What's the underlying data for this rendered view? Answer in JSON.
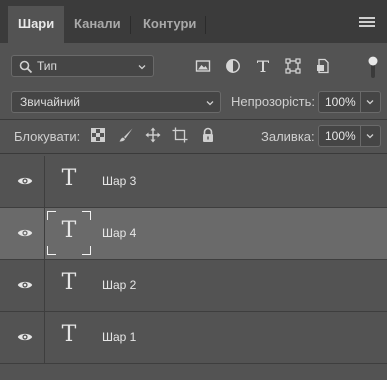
{
  "tabs": [
    {
      "label": "Шари",
      "active": true
    },
    {
      "label": "Канали",
      "active": false
    },
    {
      "label": "Контури",
      "active": false
    }
  ],
  "filter": {
    "kind_label": "Тип",
    "icons": [
      "image-filter-icon",
      "adjustment-filter-icon",
      "type-filter-icon",
      "shape-filter-icon",
      "smart-object-filter-icon"
    ]
  },
  "blend": {
    "mode": "Звичайний",
    "opacity_label": "Непрозорість:",
    "opacity_value": "100%"
  },
  "lock": {
    "label": "Блокувати:",
    "fill_label": "Заливка:",
    "fill_value": "100%"
  },
  "layers": [
    {
      "name": "Шар 3",
      "selected": false,
      "visible": true
    },
    {
      "name": "Шар 4",
      "selected": true,
      "visible": true
    },
    {
      "name": "Шар 2",
      "selected": false,
      "visible": true
    },
    {
      "name": "Шар 1",
      "selected": false,
      "visible": true
    }
  ],
  "thumb_glyph": "T",
  "colors": {
    "panel": "#535353",
    "tabbar": "#3b3b3b",
    "selected_row": "#6a6a6a",
    "text": "#e6e6e6"
  }
}
